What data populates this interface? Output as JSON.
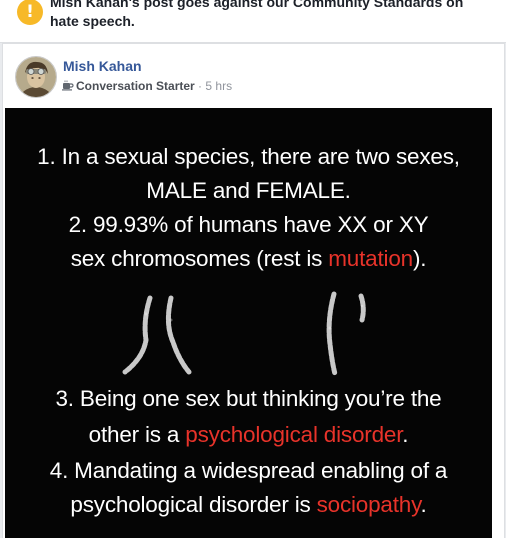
{
  "banner": {
    "icon": "warning-icon",
    "icon_color": "#f7b928",
    "text": "Mish Kahan's post goes against our Community Standards on hate speech."
  },
  "post": {
    "author": "Mish Kahan",
    "badge_icon": "coffee-cup-icon",
    "badge": "Conversation Starter",
    "separator": "·",
    "time": "5 hrs",
    "image_text": {
      "line1": "1. In a sexual species, there are two sexes,",
      "line2": "MALE and FEMALE.",
      "line3": "2. 99.93% of humans have XX or XY",
      "line4_pre": "sex chromosomes (rest is ",
      "line4_red": "mutation",
      "line4_post": ").",
      "line5": "3. Being one sex but thinking you’re the",
      "line6_pre": "other is a ",
      "line6_red": "psychological disorder",
      "line6_post": ".",
      "line7": "4. Mandating a widespread enabling of a",
      "line8_pre": "psychological disorder is ",
      "line8_red": "sociopathy",
      "line8_post": "."
    },
    "highlight_color": "#e8332a"
  }
}
